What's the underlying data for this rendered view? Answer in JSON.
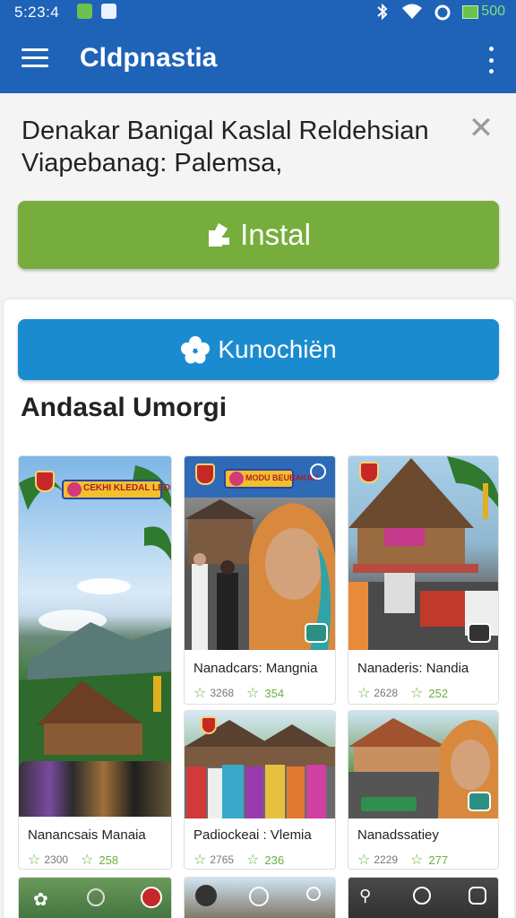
{
  "status": {
    "time": "5:23:4",
    "battery": "500"
  },
  "app": {
    "title": "Cldpnastia"
  },
  "banner": {
    "line1": "Denakar Banigal Kaslal Reldehsian",
    "line2": "Viapebanag: Palemsa,"
  },
  "install": {
    "label": "Instal"
  },
  "secondary": {
    "label": "Kunochiën"
  },
  "section": {
    "title": "Andasal Umorgi"
  },
  "cards": [
    {
      "title": "Nanancsais Manaia",
      "stat1": "2300",
      "stat2": "258"
    },
    {
      "title": "Nanadcars: Mangnia",
      "stat1": "3268",
      "stat2": "354"
    },
    {
      "title": "Nanaderis: Nandia",
      "stat1": "2628",
      "stat2": "252"
    },
    {
      "title": "Padiockeai : Vlemia",
      "stat1": "2765",
      "stat2": "236"
    },
    {
      "title": "Nanadssatiey",
      "stat1": "2229",
      "stat2": "277"
    }
  ],
  "card_signs": {
    "card1": "CEKHI KLEDAL LEDDI",
    "card2": "MODU BEUBAKAH"
  },
  "colors": {
    "appbar": "#1f63b8",
    "install": "#77ad3c",
    "secondary": "#1b8bd0",
    "accent_green": "#6cae3f"
  },
  "icons": [
    "menu-icon",
    "more-vert-icon",
    "close-icon",
    "install-icon",
    "flower-icon",
    "star-icon",
    "bluetooth-icon",
    "wifi-icon"
  ]
}
